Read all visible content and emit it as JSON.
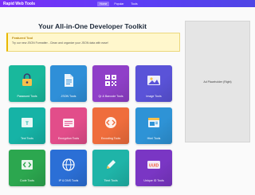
{
  "header": {
    "brand": "Rapid Web Tools",
    "nav": [
      {
        "label": "Home",
        "active": true
      },
      {
        "label": "Popular",
        "active": false
      },
      {
        "label": "Tools",
        "active": false
      }
    ]
  },
  "main": {
    "headline": "Your All-in-One Developer Toolkit",
    "featured": {
      "title": "Featured Tool",
      "text": "Try our new JSON Formatter - Clean and organize your JSON data with ease!"
    },
    "tiles": [
      {
        "label": "Password Tools",
        "icon": "lock-icon",
        "color": "#19b89c"
      },
      {
        "label": "JSON Tools",
        "icon": "document-icon",
        "color": "#2f8fd8"
      },
      {
        "label": "Qr & Barcode Tools",
        "icon": "qr-code-icon",
        "color": "#8f3fc8"
      },
      {
        "label": "Image Tools",
        "icon": "image-icon",
        "color": "#5a53d8"
      },
      {
        "label": "Text Tools",
        "icon": "text-icon",
        "color": "#16b3a6"
      },
      {
        "label": "Encryption Tools",
        "icon": "encryption-icon",
        "color": "#e24d8a"
      },
      {
        "label": "Encoding Tools",
        "icon": "code-icon",
        "color": "#ef6d3c"
      },
      {
        "label": "Html Tools",
        "icon": "html-icon",
        "color": "#2e93d6"
      },
      {
        "label": "Code Tools",
        "icon": "code-brackets-icon",
        "color": "#2ca74f"
      },
      {
        "label": "IP & DNS Tools",
        "icon": "network-icon",
        "color": "#2b6fd6"
      },
      {
        "label": "Ttext Tools",
        "icon": "pen-icon",
        "color": "#1fb4a8"
      },
      {
        "label": "Unique ID Tools",
        "icon": "id-icon",
        "color": "#7a36c4"
      }
    ]
  },
  "ad": {
    "label": "Ad Placeholder (Right)"
  }
}
